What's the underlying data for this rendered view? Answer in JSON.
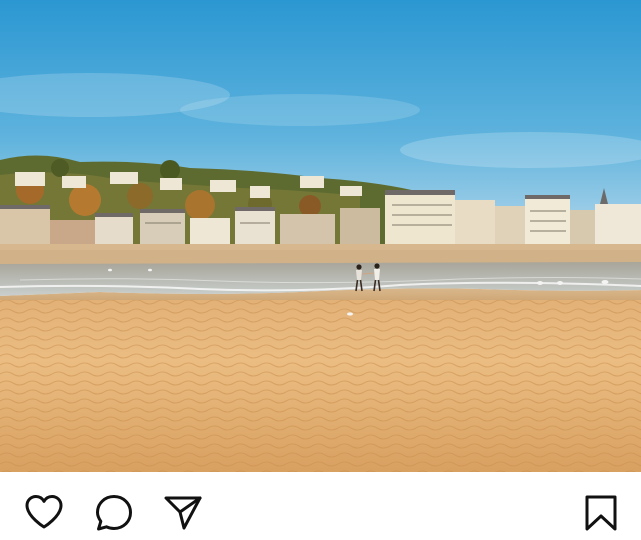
{
  "post": {
    "image": {
      "subject": "beach-with-town",
      "colors": {
        "sky_top": "#2f9fd6",
        "sky_bottom": "#a9d2ea",
        "sand_light": "#e9bd80",
        "sand_dark": "#d49a55",
        "water": "#b7c6cc",
        "hill_green": "#5b6f2e",
        "buildings": "#efe6d4"
      }
    }
  },
  "action_bar": {
    "icons": {
      "like": "heart-icon",
      "comment": "comment-bubble-icon",
      "share": "paper-plane-icon",
      "save": "bookmark-icon"
    },
    "icon_color": "#111111",
    "watermark": ""
  }
}
